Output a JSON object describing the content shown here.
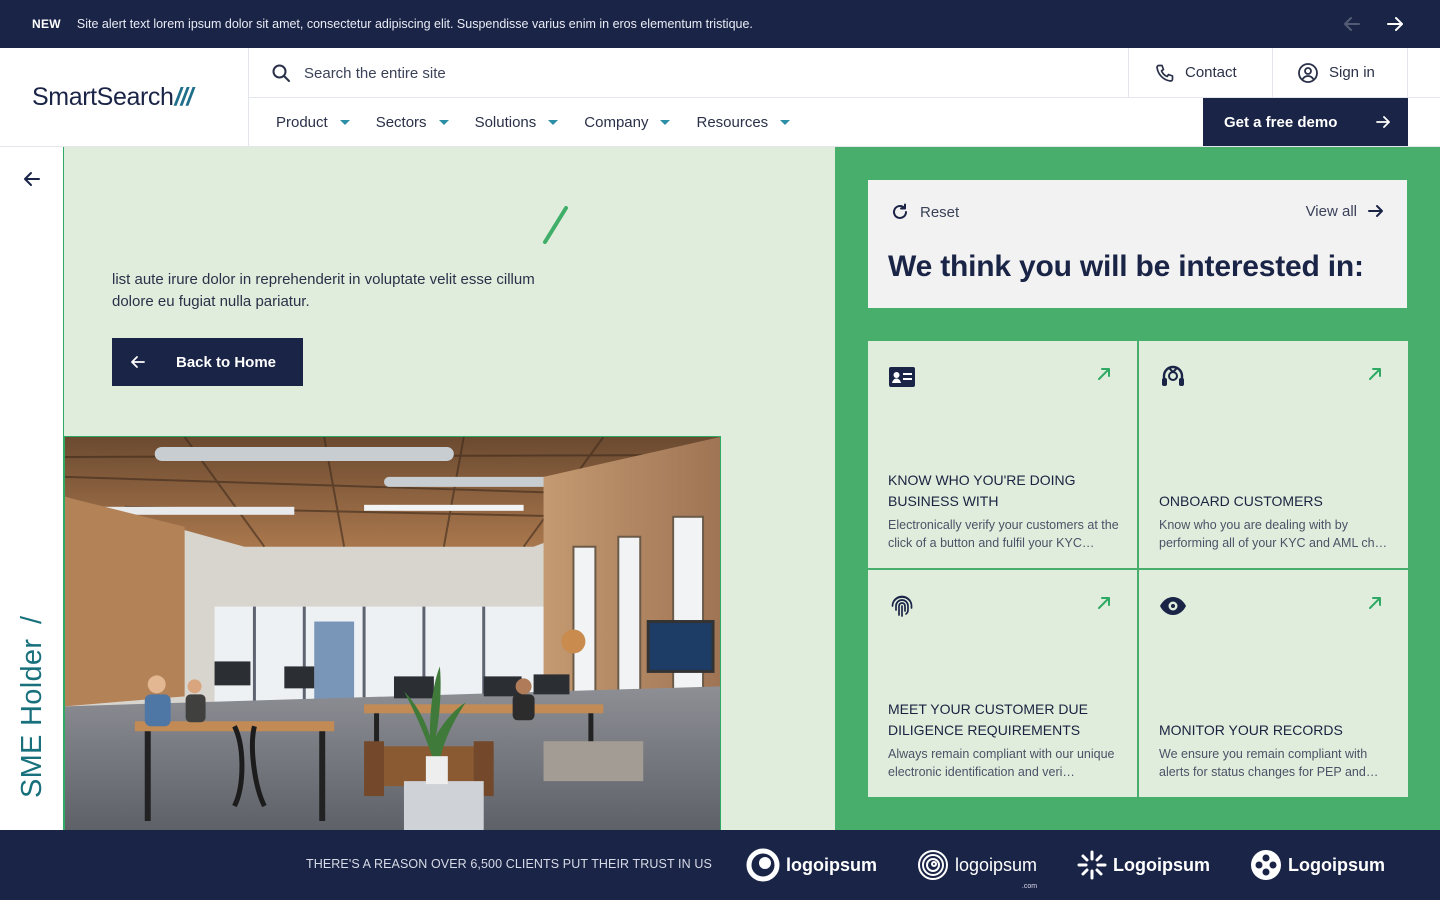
{
  "alert": {
    "badge": "NEW",
    "text": "Site alert text lorem ipsum dolor sit amet, consectetur adipiscing elit. Suspendisse varius enim in eros elementum tristique."
  },
  "header": {
    "logo_text": "SmartSearch",
    "logo_mark": "///",
    "search_placeholder": "Search the entire site",
    "contact_label": "Contact",
    "signin_label": "Sign in",
    "nav": [
      {
        "label": "Product"
      },
      {
        "label": "Sectors"
      },
      {
        "label": "Solutions"
      },
      {
        "label": "Company"
      },
      {
        "label": "Resources"
      }
    ],
    "demo_label": "Get a free demo"
  },
  "side": {
    "vertical_title": "SME Holder",
    "vertical_mark": "/"
  },
  "main": {
    "lead_text": "list aute irure dolor in reprehenderit in voluptate velit esse cillum dolore eu fugiat nulla pariatur.",
    "back_home_label": "Back to Home"
  },
  "interest": {
    "reset_label": "Reset",
    "view_all_label": "View all",
    "title": "We think you will be interested in:",
    "cards": [
      {
        "icon": "id-card-icon",
        "title": "KNOW WHO YOU'RE DOING BUSINESS WITH",
        "desc": "Electronically verify your customers at the click of a button and fulfil your KYC…"
      },
      {
        "icon": "headset-icon",
        "title": "ONBOARD CUSTOMERS",
        "desc": "Know who you are dealing with by performing all of your KYC and AML ch…"
      },
      {
        "icon": "fingerprint-icon",
        "title": "MEET YOUR CUSTOMER DUE DILIGENCE REQUIREMENTS",
        "desc": "Always remain compliant with our unique electronic identification and veri…"
      },
      {
        "icon": "eye-icon",
        "title": "MONITOR YOUR RECORDS",
        "desc": "We ensure you remain compliant with alerts for status changes for PEP and…"
      }
    ]
  },
  "footer": {
    "trust_text": "THERE'S A REASON OVER 6,500 CLIENTS PUT THEIR TRUST IN US",
    "logos": [
      {
        "label": "logoipsum",
        "icon": "ring-logo-icon"
      },
      {
        "label": "logoipsum",
        "sub": ".com",
        "icon": "spiral-logo-icon"
      },
      {
        "label": "Logoipsum",
        "icon": "burst-logo-icon"
      },
      {
        "label": "Logoipsum",
        "icon": "flower-logo-icon"
      }
    ]
  },
  "colors": {
    "navy": "#1a2446",
    "green": "#47ae6c",
    "pale_green": "#e0eddd",
    "teal": "#17707c"
  }
}
